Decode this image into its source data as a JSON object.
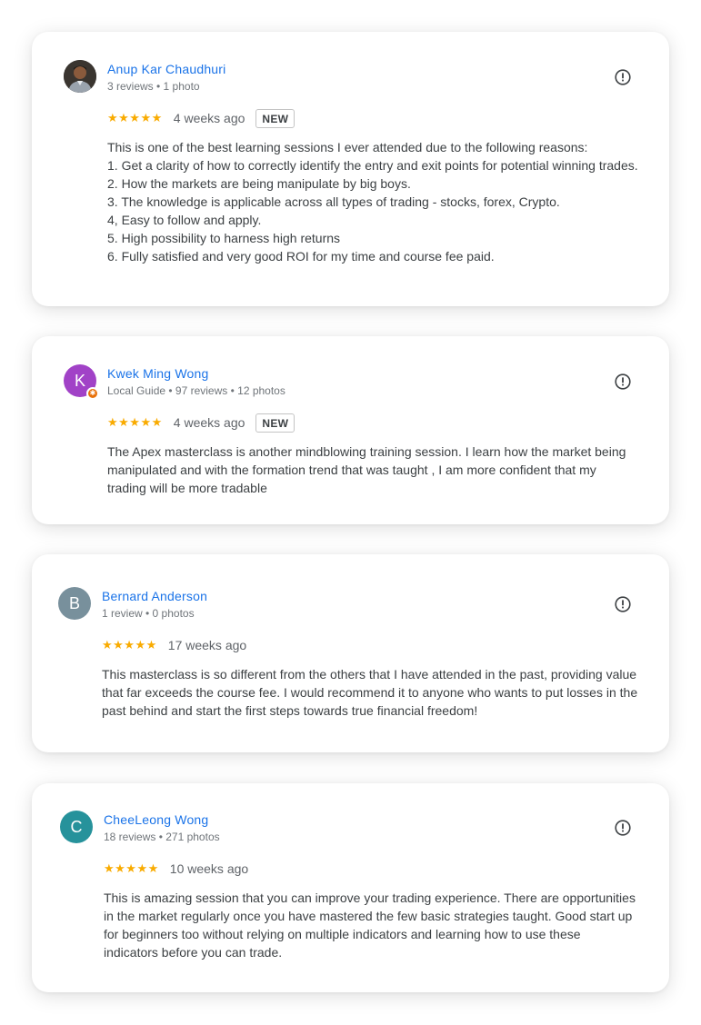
{
  "reviews": [
    {
      "name": "Anup Kar Chaudhuri",
      "meta": "3 reviews • 1 photo",
      "avatar_initial": "",
      "avatar_color": "#2b2b2b",
      "stars": "★★★★★",
      "rating": 5,
      "date": "4 weeks ago",
      "badge": "NEW",
      "text": "This is one of the best learning sessions I ever attended due to the following reasons:\n1. Get a clarity of how to correctly identify the entry and exit points for potential winning trades.\n2. How the markets are being manipulate by big boys.\n3. The knowledge is applicable across all types of trading - stocks, forex, Crypto.\n4, Easy to follow and apply.\n5. High possibility to harness high returns\n6. Fully satisfied and very good ROI for my time and course fee paid."
    },
    {
      "name": "Kwek Ming Wong",
      "meta": "Local Guide • 97 reviews • 12 photos",
      "avatar_initial": "K",
      "avatar_color": "#a142c7",
      "stars": "★★★★★",
      "rating": 5,
      "date": "4 weeks ago",
      "badge": "NEW",
      "text": "The Apex masterclass is another mindblowing training session. I learn how the market being manipulated and with the formation trend that was taught , I am more confident that my trading will be more tradable"
    },
    {
      "name": "Bernard Anderson",
      "meta": "1 review • 0 photos",
      "avatar_initial": "B",
      "avatar_color": "#78909c",
      "stars": "★★★★★",
      "rating": 5,
      "date": "17 weeks ago",
      "badge": "",
      "text": "This masterclass is so different from the others that I have attended in the past, providing value that far exceeds the course fee. I would recommend it to anyone who wants to put losses in the past behind and start the first steps towards true financial freedom!"
    },
    {
      "name": "CheeLeong Wong",
      "meta": "18 reviews • 271 photos",
      "avatar_initial": "C",
      "avatar_color": "#26929b",
      "stars": "★★★★★",
      "rating": 5,
      "date": "10 weeks ago",
      "badge": "",
      "text": "This is amazing session that you can improve your trading experience. There are opportunities in the market regularly once you have mastered the few basic strategies taught. Good start up for beginners too without relying on multiple indicators and learning how to use these indicators before you can trade."
    }
  ],
  "colors": {
    "name_link": "#1a73e8",
    "star": "#f9ab00",
    "local_guide_badge": "#e8710a"
  },
  "icons": {
    "flag": "report-icon",
    "local_guide": "local-guide-badge-icon"
  }
}
